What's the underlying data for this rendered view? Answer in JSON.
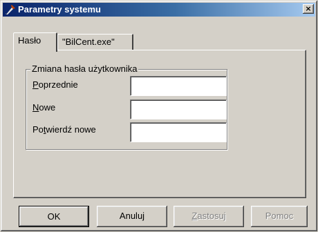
{
  "window": {
    "title": "Parametry systemu",
    "close_glyph": "×",
    "icon": "tools-icon"
  },
  "tabs": [
    {
      "label": "Hasło",
      "active": true
    },
    {
      "label": "\"BilCent.exe\"",
      "active": false
    }
  ],
  "group": {
    "legend": "Zmiana hasła użytkownika",
    "fields": [
      {
        "label_accel": "P",
        "label_rest": "oprzednie",
        "value": ""
      },
      {
        "label_accel": "N",
        "label_rest": "owe",
        "value": ""
      },
      {
        "label_pre": "Po",
        "label_accel": "t",
        "label_rest": "wierdź nowe",
        "value": ""
      }
    ]
  },
  "buttons": {
    "ok": "OK",
    "cancel": "Anuluj",
    "apply_accel": "Z",
    "apply_rest": "astosuj",
    "help": "Pomoc"
  },
  "colors": {
    "face": "#d4d0c8",
    "title_start": "#0a246a",
    "title_end": "#a6caf0",
    "disabled_text": "#808080"
  }
}
